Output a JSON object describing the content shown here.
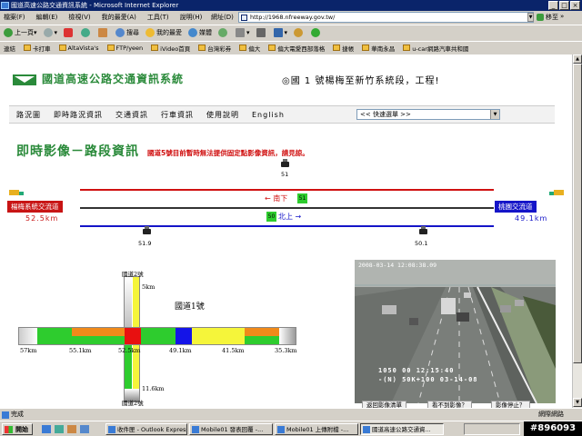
{
  "window": {
    "title": "國道高速公路交通資訊系統 - Microsoft Internet Explorer",
    "controls": [
      "_",
      "□",
      "×"
    ]
  },
  "menu": [
    "檔案(F)",
    "編輯(E)",
    "檢視(V)",
    "我的最愛(A)",
    "工具(T)",
    "說明(H)"
  ],
  "address": {
    "label": "網址(D)",
    "value": "http://1968.nfreeway.gov.tw/",
    "go": "移至",
    "links": "»"
  },
  "toolbar": {
    "back": "上一頁",
    "search": "搜尋",
    "favorites": "我的最愛",
    "media": "媒體"
  },
  "linksbar": {
    "label": "連結",
    "items": [
      "卡打車",
      "AltaVista's",
      "FTP/yeen",
      "iVideo首頁",
      "台灣彩券",
      "偏大",
      "偏大電愛西部落格",
      "捷帳",
      "華南永昌",
      "u-car網路汽車共和國"
    ]
  },
  "site": {
    "title": "國道高速公路交通資訊系統",
    "marquee": "◎國 1 號楊梅至新竹系統段，工程!",
    "nav": [
      "路況圖",
      "即時路況資訊",
      "交通資訊",
      "行車資訊",
      "使用說明",
      "English"
    ],
    "quick_select": "<< 快速選單 >>",
    "heading": "即時影像－路段資訊",
    "notice": "國道5號目前暫時無法提供固定點影像資訊，請見諒。"
  },
  "section": {
    "left_ic": "楊梅系統交流道",
    "left_km": "52.5km",
    "right_ic": "桃園交流道",
    "right_km": "49.1km",
    "south_label": "← 南下",
    "south_box": "51",
    "north_label": "北上 →",
    "north_box": "50",
    "cam_top": "51",
    "cam_bottom_left": "51.9",
    "cam_bottom_right": "50.1"
  },
  "intersection": {
    "top_label": "國道2號",
    "bottom_label": "國道2號",
    "center_label": "國道1號",
    "top_km": "5km",
    "bottom_km": "11.6km",
    "horizontal_km": [
      "57km",
      "55.1km",
      "52.5km",
      "49.1km",
      "41.5km",
      "35.3km"
    ]
  },
  "camera": {
    "timestamp": "2008-03-14 12:08:38.09",
    "overlay1": "1050      00  12:15:40",
    "overlay2": "  -(N) 50K+100  03-14-08",
    "buttons": [
      "返回影像清單",
      "看不到影像？",
      "影像停止？"
    ]
  },
  "status": {
    "text": "完成",
    "zone": "網際網路"
  },
  "taskbar": {
    "start": "開始",
    "tasks": [
      "收件匣 - Outlook Express",
      "Mobile01 發表回覆 -...",
      "Mobile01 上傳附檔 -...",
      "國道高速公路交通資..."
    ],
    "watermark": "#896093"
  },
  "colors": {
    "green": "#2a8a3a",
    "red_ic": "#c81414",
    "blue_ic": "#1414c8",
    "title_bar": "#0a246a"
  }
}
